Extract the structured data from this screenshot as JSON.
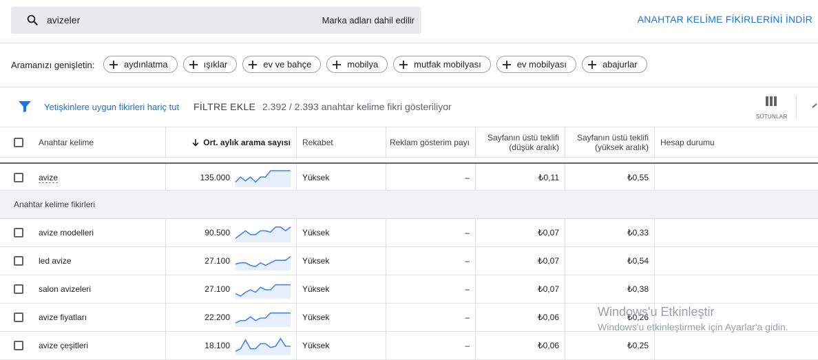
{
  "search": {
    "query": "avizeler",
    "brand_note": "Marka adları dahil edilir",
    "icon": "search-icon"
  },
  "download_label": "ANAHTAR KELİME FİKİRLERİNİ İNDİR",
  "broaden": {
    "label": "Aramanızı genişletin:",
    "chips": [
      "aydınlatma",
      "ışıklar",
      "ev ve bahçe",
      "mobilya",
      "mutfak mobilyası",
      "ev mobilyası",
      "abajurlar"
    ]
  },
  "filters": {
    "adult_exclude": "Yetişkinlere uygun fikirleri hariç tut",
    "add_filter": "FİLTRE EKLE",
    "count_text": "2.392 / 2.393 anahtar kelime fikri gösteriliyor",
    "columns_label": "SÜTUNLAR"
  },
  "table": {
    "headers": {
      "keyword": "Anahtar kelime",
      "searches": "Ort. aylık arama sayısı",
      "competition": "Rekabet",
      "impression_share": "Reklam gösterim payı",
      "bid_low": "Sayfanın üstü teklifi (düşük aralık)",
      "bid_high": "Sayfanın üstü teklifi (yüksek aralık)",
      "account_status": "Hesap durumu"
    },
    "provided": {
      "keyword": "avize",
      "searches": "135.000",
      "competition": "Yüksek",
      "impression_share": "–",
      "bid_low": "₺0,11",
      "bid_high": "₺0,55",
      "trend": [
        3,
        7,
        4,
        7,
        3,
        7,
        7,
        12,
        12,
        12,
        12,
        12
      ]
    },
    "section_label": "Anahtar kelime fikirleri",
    "rows": [
      {
        "keyword": "avize modelleri",
        "searches": "90.500",
        "competition": "Yüksek",
        "impression_share": "–",
        "bid_low": "₺0,07",
        "bid_high": "₺0,33",
        "trend": [
          2,
          5,
          8,
          5,
          5,
          8,
          8,
          7,
          11,
          11,
          8,
          11
        ]
      },
      {
        "keyword": "led avize",
        "searches": "27.100",
        "competition": "Yüksek",
        "impression_share": "–",
        "bid_low": "₺0,07",
        "bid_high": "₺0,54",
        "trend": [
          4,
          5,
          5,
          3,
          2,
          5,
          3,
          5,
          7,
          7,
          7,
          10
        ]
      },
      {
        "keyword": "salon avizeleri",
        "searches": "27.100",
        "competition": "Yüksek",
        "impression_share": "–",
        "bid_low": "₺0,07",
        "bid_high": "₺0,38",
        "trend": [
          3,
          1,
          4,
          6,
          4,
          8,
          6,
          6,
          10,
          10,
          10,
          10
        ]
      },
      {
        "keyword": "avize fiyatları",
        "searches": "22.200",
        "competition": "Yüksek",
        "impression_share": "–",
        "bid_low": "₺0,06",
        "bid_high": "₺0,26",
        "trend": [
          2,
          4,
          4,
          7,
          4,
          6,
          6,
          10,
          10,
          10,
          10,
          10
        ]
      },
      {
        "keyword": "avize çeşitleri",
        "searches": "18.100",
        "competition": "Yüksek",
        "impression_share": "–",
        "bid_low": "₺0,06",
        "bid_high": "₺0,25",
        "trend": [
          2,
          4,
          11,
          4,
          4,
          8,
          8,
          5,
          6,
          12,
          6,
          6
        ]
      }
    ]
  },
  "watermark": {
    "title": "Windows'u Etkinleştir",
    "subtitle": "Windows'u etkinleştirmek için Ayarlar'a gidin."
  },
  "colors": {
    "accent": "#1a73e8",
    "spark_line": "#4285f4",
    "spark_fill": "#e8f0fe"
  }
}
